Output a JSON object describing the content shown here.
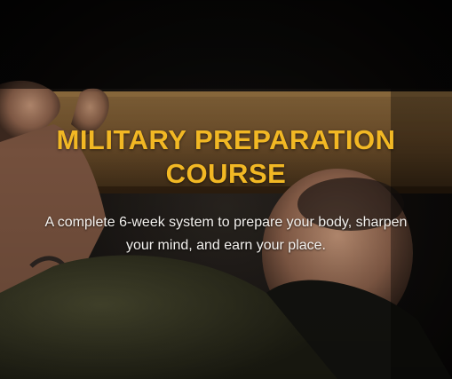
{
  "hero": {
    "title_line1": "MILITARY PREPARATION",
    "title_line2": "COURSE",
    "subtitle_line1": "A complete 6-week system to prepare your body, sharpen",
    "subtitle_line2": "your mind, and earn your place.",
    "colors": {
      "title": "#f2b824",
      "subtitle": "#f3f1ee",
      "background": "#0c0b0a",
      "bar_wood": "#7a5a33",
      "shirt": "#3a3a26"
    }
  }
}
